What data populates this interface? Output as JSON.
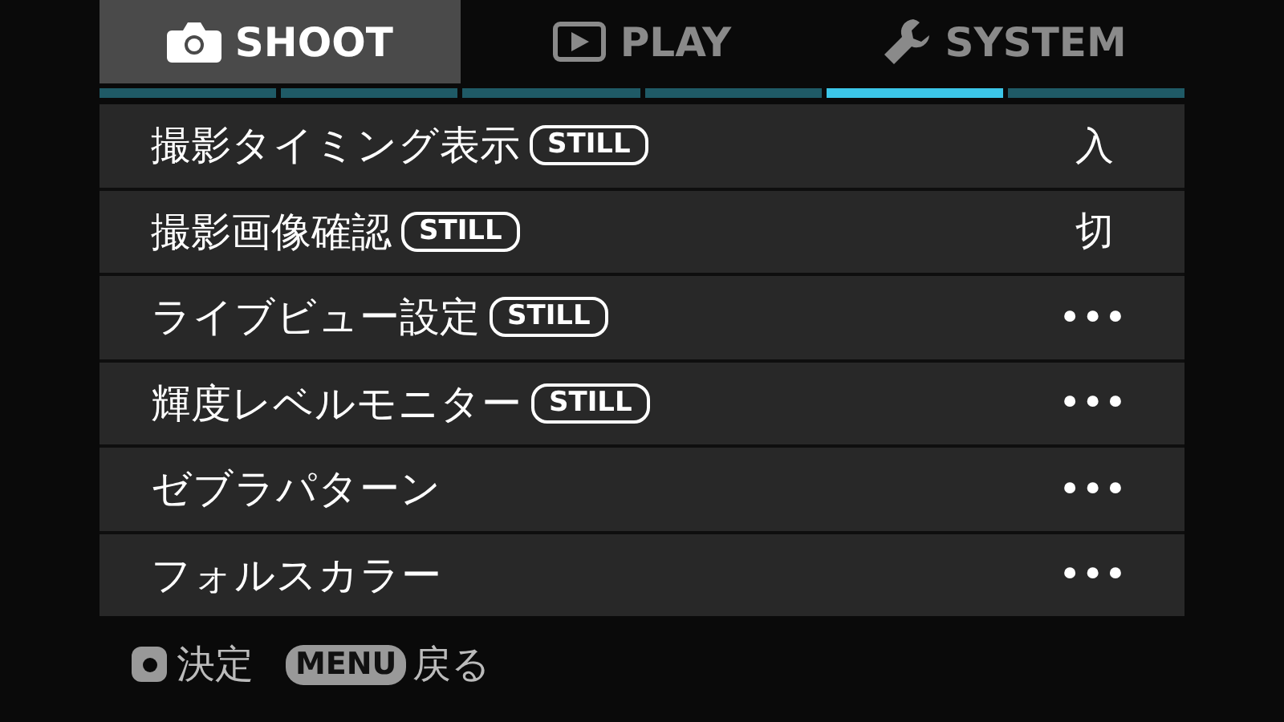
{
  "tabs": [
    {
      "label": "SHOOT",
      "kind": "camera",
      "selected": true
    },
    {
      "label": "PLAY",
      "kind": "play",
      "selected": false
    },
    {
      "label": "SYSTEM",
      "kind": "wrench",
      "selected": false
    }
  ],
  "pages": [
    {
      "selected": false
    },
    {
      "selected": false
    },
    {
      "selected": false
    },
    {
      "selected": false
    },
    {
      "selected": true
    },
    {
      "selected": false
    }
  ],
  "rows": [
    {
      "label": "撮影タイミング表示",
      "badge": "STILL",
      "value": "入"
    },
    {
      "label": "撮影画像確認",
      "badge": "STILL",
      "value": "切"
    },
    {
      "label": "ライブビュー設定",
      "badge": "STILL",
      "value": "•••"
    },
    {
      "label": "輝度レベルモニター",
      "badge": "STILL",
      "value": "•••"
    },
    {
      "label": "ゼブラパターン",
      "value": "•••"
    },
    {
      "label": "フォルスカラー",
      "value": "•••"
    }
  ],
  "footer": [
    {
      "kind": "dot",
      "label": "決定"
    },
    {
      "kind": "key",
      "key": "MENU",
      "label": "戻る"
    }
  ]
}
